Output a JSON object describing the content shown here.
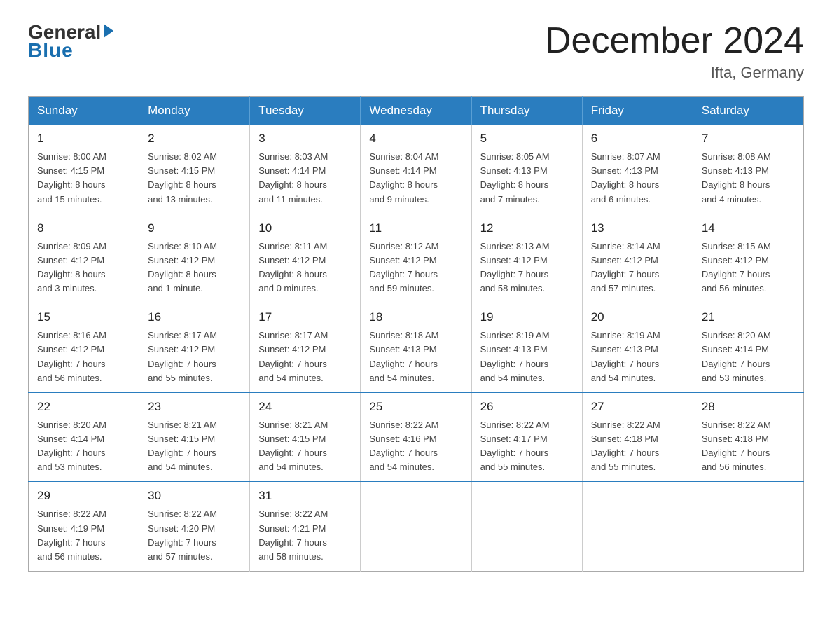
{
  "header": {
    "logo": {
      "general": "General",
      "blue": "Blue",
      "arrow": "▶"
    },
    "title": "December 2024",
    "location": "Ifta, Germany"
  },
  "days_of_week": [
    "Sunday",
    "Monday",
    "Tuesday",
    "Wednesday",
    "Thursday",
    "Friday",
    "Saturday"
  ],
  "weeks": [
    [
      {
        "day": "1",
        "sunrise": "8:00 AM",
        "sunset": "4:15 PM",
        "daylight": "8 hours and 15 minutes."
      },
      {
        "day": "2",
        "sunrise": "8:02 AM",
        "sunset": "4:15 PM",
        "daylight": "8 hours and 13 minutes."
      },
      {
        "day": "3",
        "sunrise": "8:03 AM",
        "sunset": "4:14 PM",
        "daylight": "8 hours and 11 minutes."
      },
      {
        "day": "4",
        "sunrise": "8:04 AM",
        "sunset": "4:14 PM",
        "daylight": "8 hours and 9 minutes."
      },
      {
        "day": "5",
        "sunrise": "8:05 AM",
        "sunset": "4:13 PM",
        "daylight": "8 hours and 7 minutes."
      },
      {
        "day": "6",
        "sunrise": "8:07 AM",
        "sunset": "4:13 PM",
        "daylight": "8 hours and 6 minutes."
      },
      {
        "day": "7",
        "sunrise": "8:08 AM",
        "sunset": "4:13 PM",
        "daylight": "8 hours and 4 minutes."
      }
    ],
    [
      {
        "day": "8",
        "sunrise": "8:09 AM",
        "sunset": "4:12 PM",
        "daylight": "8 hours and 3 minutes."
      },
      {
        "day": "9",
        "sunrise": "8:10 AM",
        "sunset": "4:12 PM",
        "daylight": "8 hours and 1 minute."
      },
      {
        "day": "10",
        "sunrise": "8:11 AM",
        "sunset": "4:12 PM",
        "daylight": "8 hours and 0 minutes."
      },
      {
        "day": "11",
        "sunrise": "8:12 AM",
        "sunset": "4:12 PM",
        "daylight": "7 hours and 59 minutes."
      },
      {
        "day": "12",
        "sunrise": "8:13 AM",
        "sunset": "4:12 PM",
        "daylight": "7 hours and 58 minutes."
      },
      {
        "day": "13",
        "sunrise": "8:14 AM",
        "sunset": "4:12 PM",
        "daylight": "7 hours and 57 minutes."
      },
      {
        "day": "14",
        "sunrise": "8:15 AM",
        "sunset": "4:12 PM",
        "daylight": "7 hours and 56 minutes."
      }
    ],
    [
      {
        "day": "15",
        "sunrise": "8:16 AM",
        "sunset": "4:12 PM",
        "daylight": "7 hours and 56 minutes."
      },
      {
        "day": "16",
        "sunrise": "8:17 AM",
        "sunset": "4:12 PM",
        "daylight": "7 hours and 55 minutes."
      },
      {
        "day": "17",
        "sunrise": "8:17 AM",
        "sunset": "4:12 PM",
        "daylight": "7 hours and 54 minutes."
      },
      {
        "day": "18",
        "sunrise": "8:18 AM",
        "sunset": "4:13 PM",
        "daylight": "7 hours and 54 minutes."
      },
      {
        "day": "19",
        "sunrise": "8:19 AM",
        "sunset": "4:13 PM",
        "daylight": "7 hours and 54 minutes."
      },
      {
        "day": "20",
        "sunrise": "8:19 AM",
        "sunset": "4:13 PM",
        "daylight": "7 hours and 54 minutes."
      },
      {
        "day": "21",
        "sunrise": "8:20 AM",
        "sunset": "4:14 PM",
        "daylight": "7 hours and 53 minutes."
      }
    ],
    [
      {
        "day": "22",
        "sunrise": "8:20 AM",
        "sunset": "4:14 PM",
        "daylight": "7 hours and 53 minutes."
      },
      {
        "day": "23",
        "sunrise": "8:21 AM",
        "sunset": "4:15 PM",
        "daylight": "7 hours and 54 minutes."
      },
      {
        "day": "24",
        "sunrise": "8:21 AM",
        "sunset": "4:15 PM",
        "daylight": "7 hours and 54 minutes."
      },
      {
        "day": "25",
        "sunrise": "8:22 AM",
        "sunset": "4:16 PM",
        "daylight": "7 hours and 54 minutes."
      },
      {
        "day": "26",
        "sunrise": "8:22 AM",
        "sunset": "4:17 PM",
        "daylight": "7 hours and 55 minutes."
      },
      {
        "day": "27",
        "sunrise": "8:22 AM",
        "sunset": "4:18 PM",
        "daylight": "7 hours and 55 minutes."
      },
      {
        "day": "28",
        "sunrise": "8:22 AM",
        "sunset": "4:18 PM",
        "daylight": "7 hours and 56 minutes."
      }
    ],
    [
      {
        "day": "29",
        "sunrise": "8:22 AM",
        "sunset": "4:19 PM",
        "daylight": "7 hours and 56 minutes."
      },
      {
        "day": "30",
        "sunrise": "8:22 AM",
        "sunset": "4:20 PM",
        "daylight": "7 hours and 57 minutes."
      },
      {
        "day": "31",
        "sunrise": "8:22 AM",
        "sunset": "4:21 PM",
        "daylight": "7 hours and 58 minutes."
      },
      null,
      null,
      null,
      null
    ]
  ],
  "labels": {
    "sunrise": "Sunrise:",
    "sunset": "Sunset:",
    "daylight": "Daylight:"
  }
}
